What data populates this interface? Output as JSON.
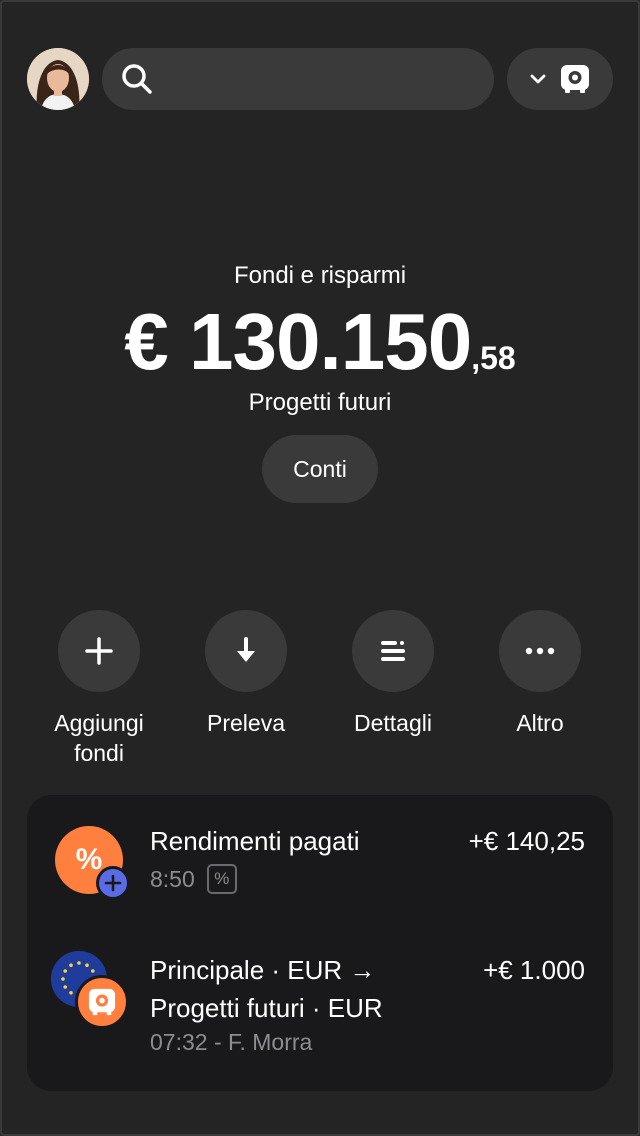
{
  "header": {
    "avatar_icon": "user-avatar-photo",
    "search_icon": "search-icon",
    "search_placeholder": "",
    "switch_chevron_icon": "chevron-down-icon",
    "switch_vault_icon": "vault-icon"
  },
  "balance": {
    "section_title": "Fondi e risparmi",
    "amount_main": "€ 130.150",
    "amount_decimals": ",58",
    "pocket_name": "Progetti futuri",
    "accounts_button": "Conti"
  },
  "actions": [
    {
      "label_line1": "Aggiungi",
      "label_line2": "fondi",
      "icon": "plus-icon"
    },
    {
      "label_line1": "Preleva",
      "label_line2": "",
      "icon": "arrow-down-icon"
    },
    {
      "label_line1": "Dettagli",
      "label_line2": "",
      "icon": "details-list-icon"
    },
    {
      "label_line1": "Altro",
      "label_line2": "",
      "icon": "more-dots-icon"
    }
  ],
  "transactions": [
    {
      "title": "Rendimenti pagati",
      "amount": "+€ 140,25",
      "time": "8:50",
      "tag": "%",
      "icon": "percent-icon",
      "badge_icon": "plus-badge-icon"
    },
    {
      "title_line1": "Principale · EUR →",
      "title_line2": "Progetti futuri · EUR",
      "amount": "+€ 1.000",
      "meta": "07:32 - F. Morra",
      "icon": "eu-flag-icon",
      "badge_icon": "vault-icon"
    }
  ],
  "colors": {
    "background": "#242424",
    "surface": "#3a3a3a",
    "card": "#19191b",
    "accent_orange": "#ff7f3f",
    "accent_blue": "#5a6be6",
    "muted_text": "#8d8d91"
  }
}
